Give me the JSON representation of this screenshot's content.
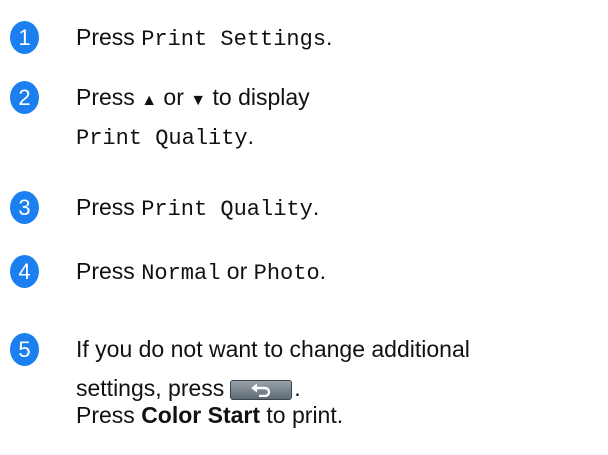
{
  "steps": [
    {
      "num": "1",
      "press": "Press",
      "item": "Print Settings",
      "end": "."
    },
    {
      "num": "2",
      "press": "Press",
      "up": "▲",
      "or": "or",
      "down": "▼",
      "rest": "to display",
      "item": "Print Quality",
      "end": "."
    },
    {
      "num": "3",
      "press": "Press",
      "item": "Print Quality",
      "end": "."
    },
    {
      "num": "4",
      "press": "Press",
      "opt1": "Normal",
      "or": "or",
      "opt2": "Photo",
      "end": "."
    },
    {
      "num": "5",
      "line1": "If you do not want to change additional",
      "line2": "settings, press",
      "end2": ".",
      "press": "Press",
      "button": "Color Start",
      "line3_end": "to print.",
      "icon": "back-arrow-icon"
    }
  ]
}
